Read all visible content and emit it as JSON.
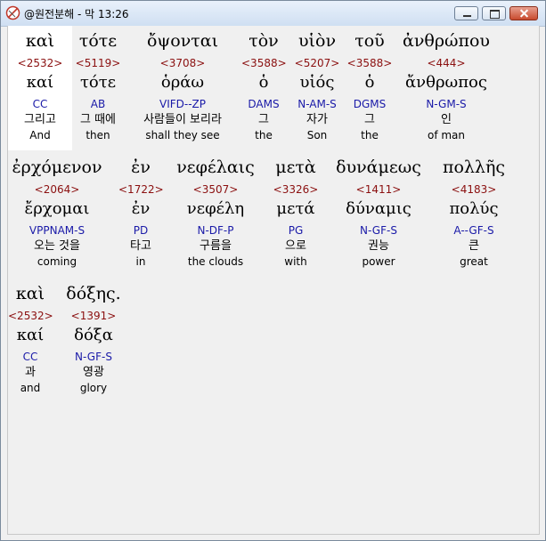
{
  "window": {
    "title": "@원전분해 - 막 13:26"
  },
  "rows": [
    [
      {
        "greek": "καὶ",
        "strong": "<2532>",
        "lemma": "καί",
        "parse": "CC",
        "korean": "그리고",
        "english": "And"
      },
      {
        "greek": "τότε",
        "strong": "<5119>",
        "lemma": "τότε",
        "parse": "AB",
        "korean": "그 때에",
        "english": "then"
      },
      {
        "greek": "ὄψονται",
        "strong": "<3708>",
        "lemma": "ὁράω",
        "parse": "VIFD--ZP",
        "korean": "사람들이 보리라",
        "english": "shall they see"
      },
      {
        "greek": "τὸν",
        "strong": "<3588>",
        "lemma": "ὁ",
        "parse": "DAMS",
        "korean": "그",
        "english": "the"
      },
      {
        "greek": "υἱὸν",
        "strong": "<5207>",
        "lemma": "υἱός",
        "parse": "N-AM-S",
        "korean": "자가",
        "english": "Son"
      },
      {
        "greek": "τοῦ",
        "strong": "<3588>",
        "lemma": "ὁ",
        "parse": "DGMS",
        "korean": "그",
        "english": "the"
      },
      {
        "greek": "ἀνθρώπου",
        "strong": "<444>",
        "lemma": "ἄνθρωπος",
        "parse": "N-GM-S",
        "korean": "인",
        "english": "of man"
      }
    ],
    [
      {
        "greek": "ἐρχόμενον",
        "strong": "<2064>",
        "lemma": "ἔρχομαι",
        "parse": "VPPNAM-S",
        "korean": "오는 것을",
        "english": "coming"
      },
      {
        "greek": "ἐν",
        "strong": "<1722>",
        "lemma": "ἐν",
        "parse": "PD",
        "korean": "타고",
        "english": "in"
      },
      {
        "greek": "νεφέλαις",
        "strong": "<3507>",
        "lemma": "νεφέλη",
        "parse": "N-DF-P",
        "korean": "구름을",
        "english": "the clouds"
      },
      {
        "greek": "μετὰ",
        "strong": "<3326>",
        "lemma": "μετά",
        "parse": "PG",
        "korean": "으로",
        "english": "with"
      },
      {
        "greek": "δυνάμεως",
        "strong": "<1411>",
        "lemma": "δύναμις",
        "parse": "N-GF-S",
        "korean": "권능",
        "english": "power"
      },
      {
        "greek": "πολλῆς",
        "strong": "<4183>",
        "lemma": "πολύς",
        "parse": "A--GF-S",
        "korean": "큰",
        "english": "great"
      }
    ],
    [
      {
        "greek": "καὶ",
        "strong": "<2532>",
        "lemma": "καί",
        "parse": "CC",
        "korean": "과",
        "english": "and"
      },
      {
        "greek": "δόξης.",
        "strong": "<1391>",
        "lemma": "δόξα",
        "parse": "N-GF-S",
        "korean": "영광",
        "english": "glory"
      }
    ]
  ]
}
